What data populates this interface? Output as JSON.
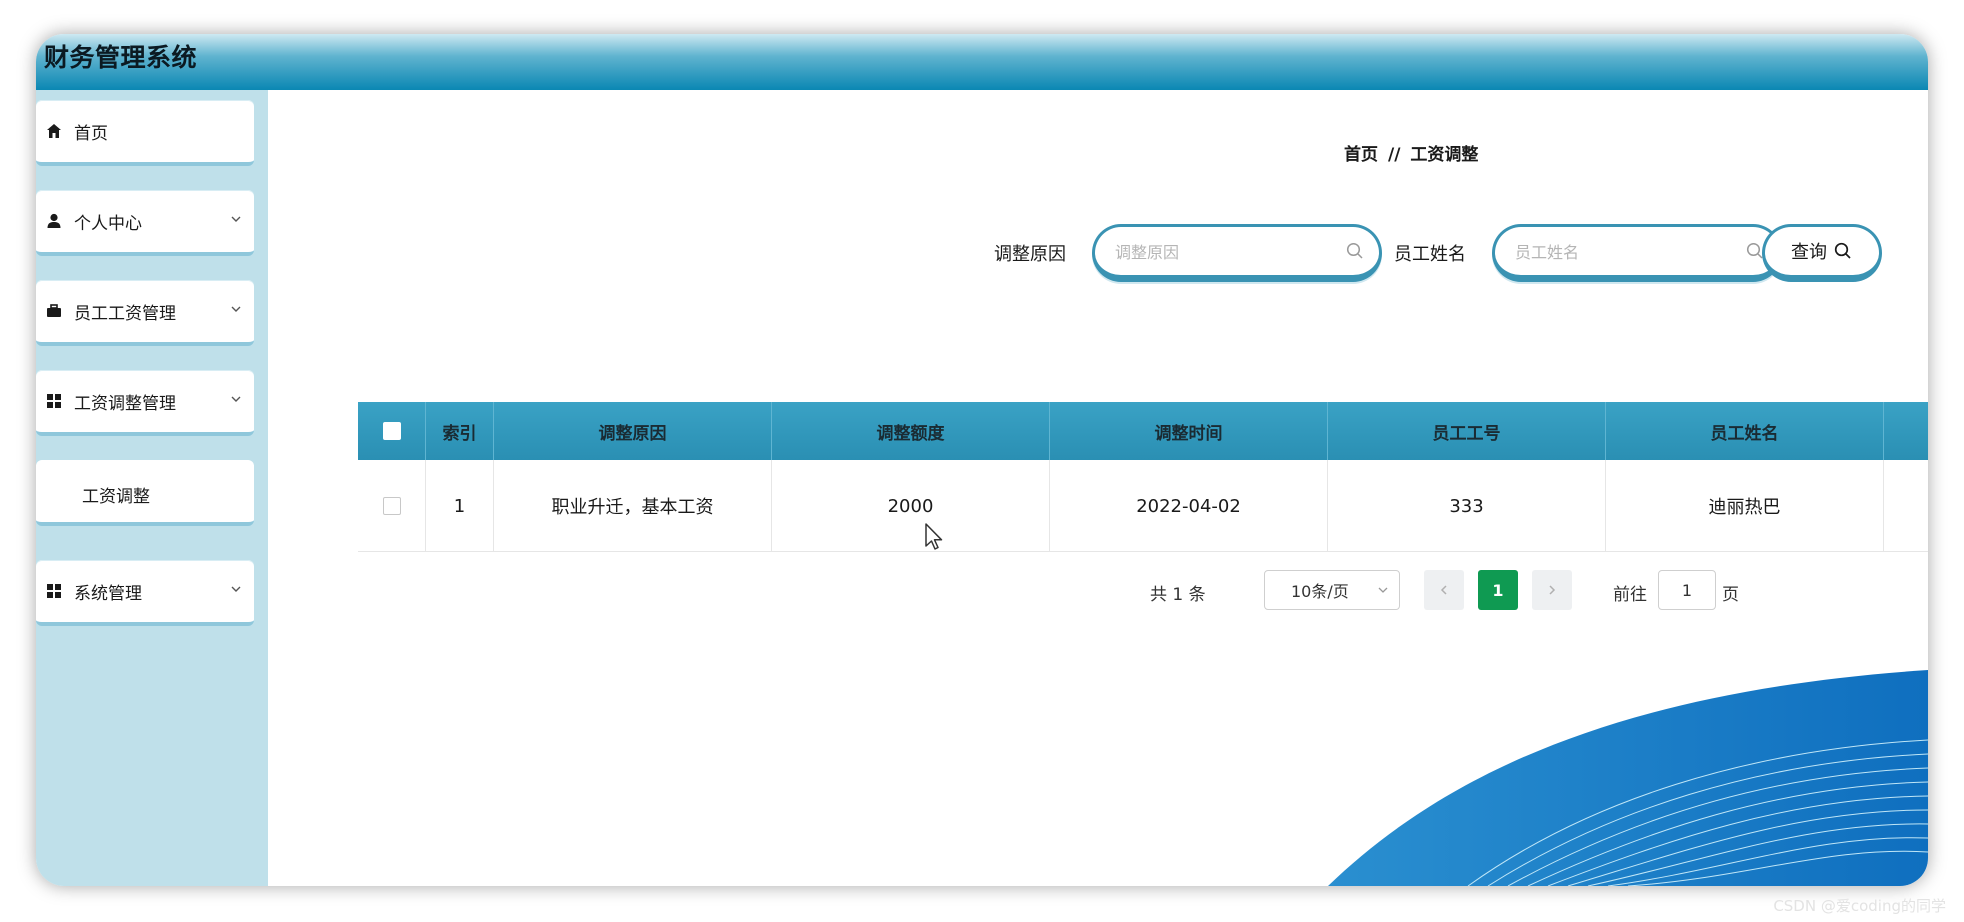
{
  "app": {
    "title": "财务管理系统"
  },
  "sidebar": {
    "items": [
      {
        "label": "首页",
        "icon": "home-icon"
      },
      {
        "label": "个人中心",
        "icon": "user-icon"
      },
      {
        "label": "员工工资管理",
        "icon": "briefcase-icon"
      },
      {
        "label": "工资调整管理",
        "icon": "grid-icon"
      },
      {
        "label": "工资调整",
        "icon": ""
      },
      {
        "label": "系统管理",
        "icon": "grid-icon"
      }
    ]
  },
  "breadcrumb": {
    "home": "首页",
    "separator": "//",
    "current": "工资调整"
  },
  "search": {
    "reason_label": "调整原因",
    "reason_placeholder": "调整原因",
    "name_label": "员工姓名",
    "name_placeholder": "员工姓名",
    "query_label": "查询"
  },
  "table": {
    "headers": [
      "索引",
      "调整原因",
      "调整额度",
      "调整时间",
      "员工工号",
      "员工姓名"
    ],
    "rows": [
      {
        "index": "1",
        "reason": "职业升迁，基本工资",
        "amount": "2000",
        "date": "2022-04-02",
        "emp_id": "333",
        "emp_name": "迪丽热巴"
      }
    ]
  },
  "pagination": {
    "total": "共 1 条",
    "page_size": "10条/页",
    "current_page": "1",
    "goto_label": "前往",
    "goto_value": "1",
    "page_suffix": "页"
  },
  "colors": {
    "header_accent": "#0a87b3",
    "sidebar_bg": "#bfe0ea",
    "table_header": "#3aa2c5",
    "pager_active": "#0f9a52"
  },
  "watermark": "CSDN @爱coding的同学"
}
